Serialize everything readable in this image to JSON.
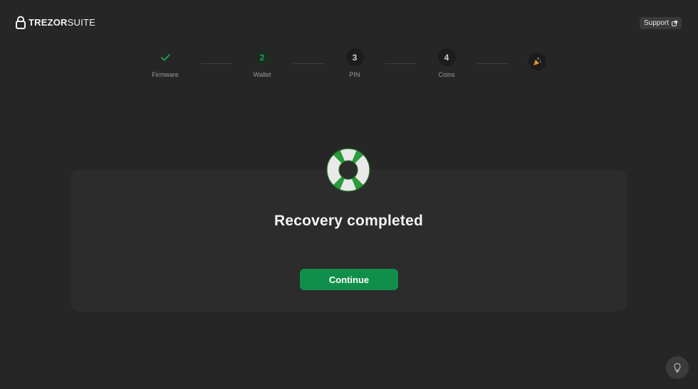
{
  "brand": {
    "name_bold": "TREZOR",
    "name_light": "SUITE"
  },
  "header": {
    "support_label": "Support"
  },
  "stepper": {
    "steps": [
      {
        "number": "",
        "label": "Firmware",
        "state": "done"
      },
      {
        "number": "2",
        "label": "Wallet",
        "state": "active"
      },
      {
        "number": "3",
        "label": "PIN",
        "state": "pending"
      },
      {
        "number": "4",
        "label": "Coins",
        "state": "pending"
      },
      {
        "number": "",
        "label": "",
        "state": "final"
      }
    ]
  },
  "card": {
    "title": "Recovery completed",
    "continue_label": "Continue"
  },
  "colors": {
    "accent": "#0f8f4a",
    "background": "#262626",
    "card": "#2c2c2c"
  },
  "icons": {
    "step_done": "checkmark-icon",
    "step_final": "party-popper-icon",
    "hero": "lifebuoy-icon",
    "tip": "lightbulb-icon",
    "support": "external-link-icon"
  }
}
